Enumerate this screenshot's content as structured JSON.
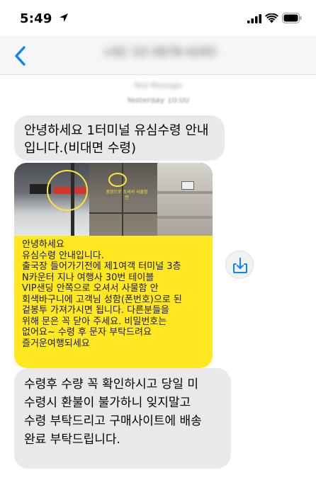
{
  "status_bar": {
    "time": "5:49"
  },
  "header": {
    "contact": "+82 10-3878-4265",
    "back_icon": "chevron-left-icon"
  },
  "meta": {
    "line1": "Text Message",
    "line2": "Yesterday 10:00"
  },
  "messages": [
    {
      "lines": [
        "안녕하세요 1터미널 유심수령 안내",
        "입니다.(비대면 수령)"
      ]
    },
    {
      "photo_caption": "중앙으로 오셔서 사물함 안",
      "text_lines": [
        "안녕하세요",
        "유심수령 안내입니다.",
        "출국장 들어가기전에 제1여객 터미널 3층",
        "N카운터 지나 여행사 30번 테이블",
        "VIP샌딩 안쪽으로 오셔서 사물함 안",
        "회색바구니에 고객님 성함(폰번호)으로 된",
        "겉봉투 가져가시면 됩니다. 다른분들을",
        "위해 문은 꼭 닫아 주세요. 비밀번호는",
        "없어요~ 수령 후 문자 부탁드려요",
        "즐거운여행되세요"
      ]
    },
    {
      "lines": [
        "수령후 수량 꼭 확인하시고 당일 미",
        "수령시 환불이 불가하니 잊지말고",
        "수령 부탁드리고 구매사이트에 배송",
        "완료 부탁드립니다."
      ]
    }
  ],
  "colors": {
    "accent": "#0a84ff",
    "bubble": "#e9e9eb",
    "yellow": "#ffe81f"
  },
  "icons": {
    "download": "download-icon",
    "location": "location-arrow-icon",
    "signal": "cellular-signal-icon",
    "wifi": "wifi-icon",
    "battery": "battery-icon"
  }
}
